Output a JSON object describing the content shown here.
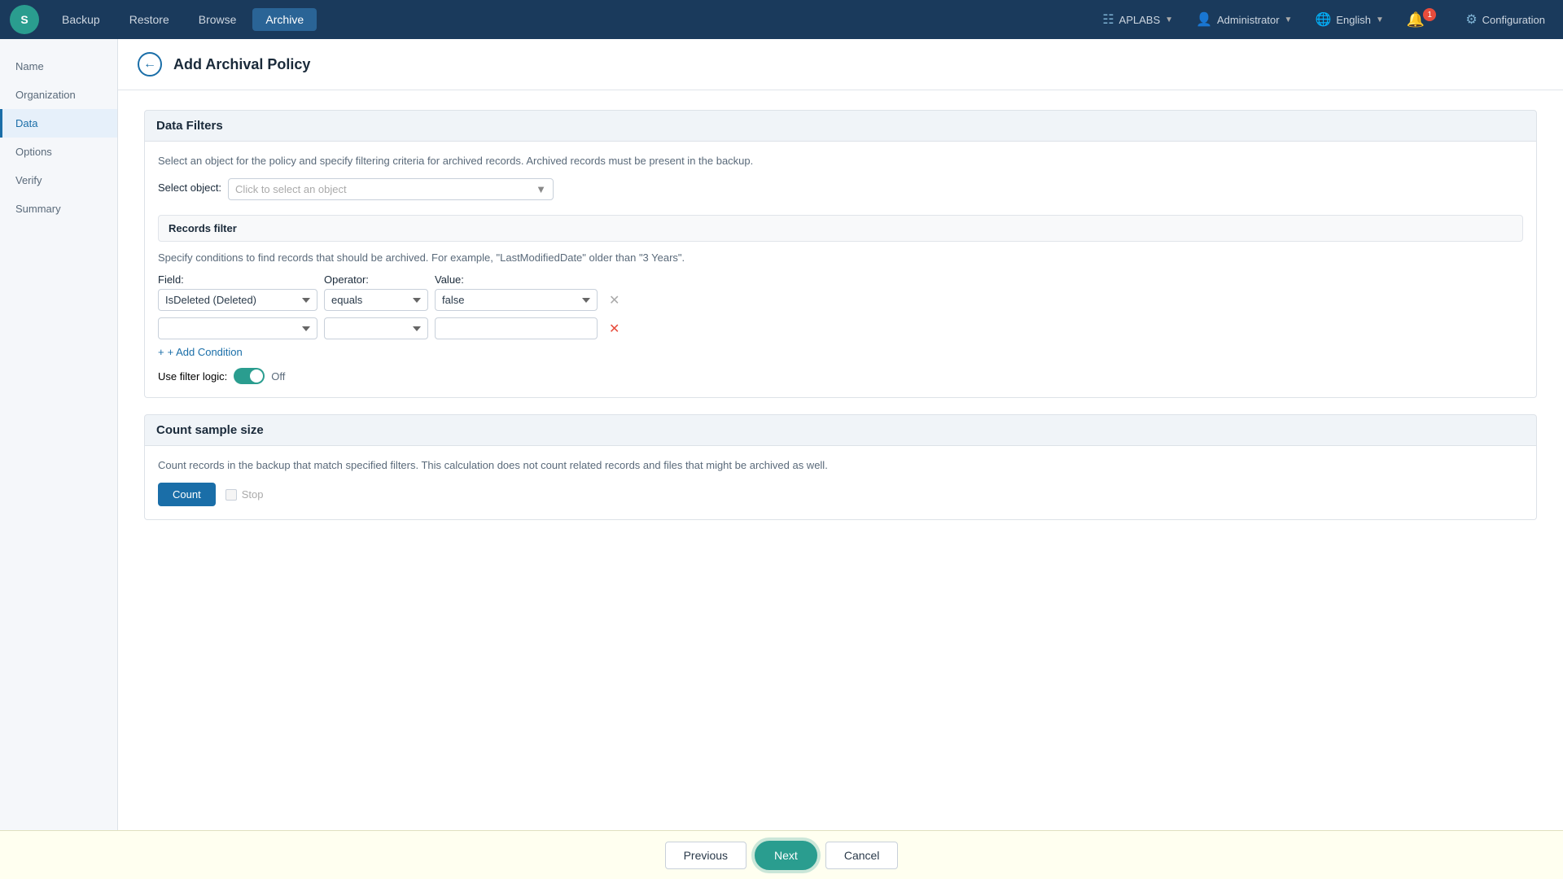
{
  "app": {
    "logo": "S",
    "nav_items": [
      {
        "label": "Backup",
        "active": false
      },
      {
        "label": "Restore",
        "active": false
      },
      {
        "label": "Browse",
        "active": false
      },
      {
        "label": "Archive",
        "active": true
      }
    ]
  },
  "top_right": {
    "org_label": "APLABS",
    "user_label": "Administrator",
    "lang_label": "English",
    "notification_count": "1",
    "config_label": "Configuration"
  },
  "sidebar": {
    "items": [
      {
        "label": "Name",
        "active": false
      },
      {
        "label": "Organization",
        "active": false
      },
      {
        "label": "Data",
        "active": true
      },
      {
        "label": "Options",
        "active": false
      },
      {
        "label": "Verify",
        "active": false
      },
      {
        "label": "Summary",
        "active": false
      }
    ]
  },
  "page": {
    "title": "Add Archival Policy",
    "back_aria": "back"
  },
  "content": {
    "section_data_filters": {
      "heading": "Data Filters",
      "help_text": "Select an object for the policy and specify filtering criteria for archived records. Archived records must be present in the backup.",
      "select_object_label": "Select object:",
      "select_object_placeholder": "Click to select an object",
      "records_filter_heading": "Records filter",
      "records_filter_help": "Specify conditions to find records that should be archived. For example, \"LastModifiedDate\" older than \"3 Years\".",
      "field_col_label": "Field:",
      "operator_col_label": "Operator:",
      "value_col_label": "Value:",
      "row1": {
        "field": "IsDeleted (Deleted)",
        "operator": "equals",
        "value": "false"
      },
      "row2": {
        "field": "",
        "operator": "",
        "value": ""
      },
      "add_condition_label": "+ Add Condition",
      "filter_logic_label": "Use filter logic:",
      "filter_logic_state": "Off"
    },
    "section_count": {
      "heading": "Count sample size",
      "help_text": "Count records in the backup that match specified filters. This calculation does not count related records and files that might be archived as well.",
      "count_btn_label": "Count",
      "stop_label": "Stop"
    }
  },
  "footer": {
    "prev_label": "Previous",
    "next_label": "Next",
    "cancel_label": "Cancel"
  }
}
